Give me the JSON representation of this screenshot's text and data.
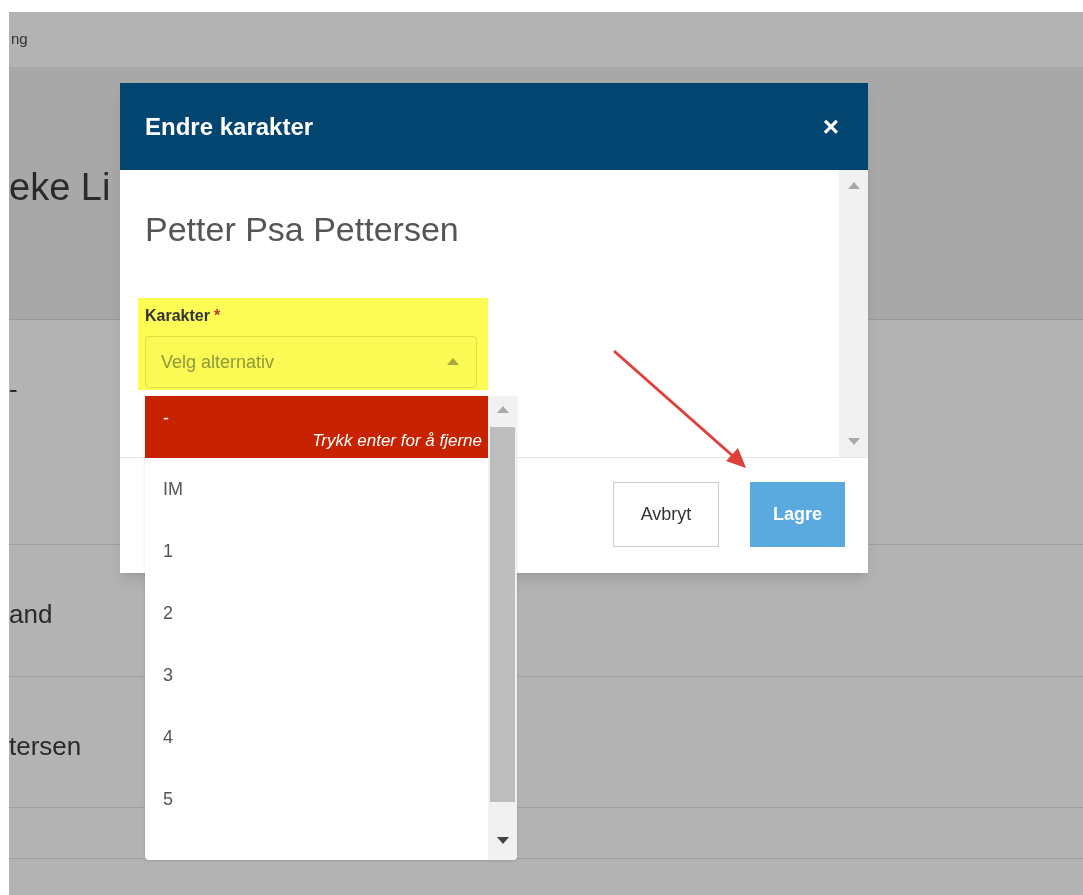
{
  "background": {
    "breadcrumb": "ng",
    "heading": "eke Li",
    "rows": [
      {
        "text": "-"
      },
      {
        "text": "and"
      },
      {
        "text": "tersen"
      },
      {
        "text": ""
      }
    ]
  },
  "dialog": {
    "title": "Endre karakter",
    "close": "×",
    "student": "Petter Psa Pettersen",
    "field": {
      "label": "Karakter",
      "required_mark": "*",
      "placeholder": "Velg alternativ",
      "highlighted": true
    },
    "options": [
      {
        "label": "-",
        "hint": "Trykk enter for å fjerne",
        "selected": true
      },
      {
        "label": "IM",
        "selected": false
      },
      {
        "label": "1",
        "selected": false
      },
      {
        "label": "2",
        "selected": false
      },
      {
        "label": "3",
        "selected": false
      },
      {
        "label": "4",
        "selected": false
      },
      {
        "label": "5",
        "selected": false
      }
    ],
    "buttons": [
      {
        "label": "Avbryt",
        "kind": "secondary"
      },
      {
        "label": "Lagre",
        "kind": "primary"
      }
    ]
  },
  "annotation": {
    "kind": "arrow"
  }
}
